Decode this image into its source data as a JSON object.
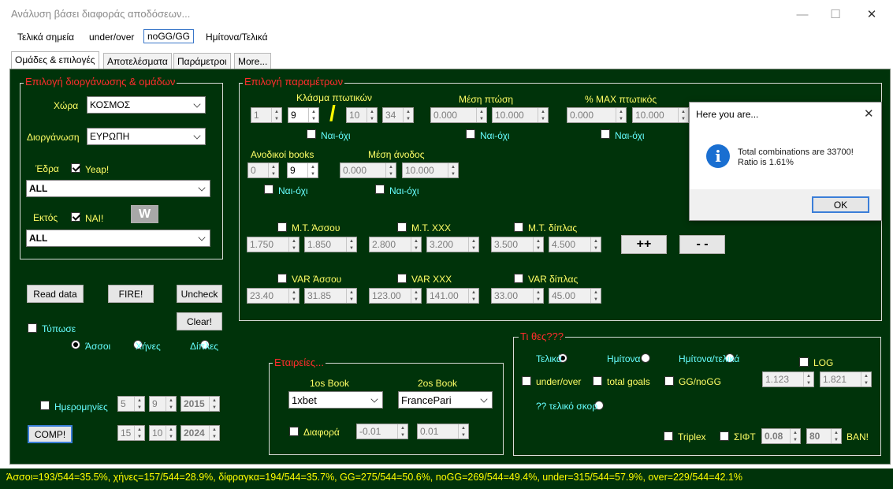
{
  "window": {
    "title": "Ανάλυση βάσει διαφοράς αποδόσεων...",
    "minimize": "—",
    "maximize": "☐",
    "close": "✕"
  },
  "menu": [
    "Τελικά σημεία",
    "under/over",
    "noGG/GG",
    "Ημίτονα/Τελικά"
  ],
  "tabs": [
    "Ομάδες & επιλογές",
    "Αποτελέσματα",
    "Παράμετροι",
    "More..."
  ],
  "teams": {
    "title": "Επιλογή διοργάνωσης & ομάδων",
    "country_label": "Χώρα",
    "country_value": "ΚΟΣΜΟΣ",
    "league_label": "Διοργάνωση",
    "league_value": "ΕΥΡΩΠΗ",
    "home_label": "Έδρα",
    "home_check": "Yeap!",
    "home_value": "ALL",
    "away_label": "Εκτός",
    "away_check": "NAI!",
    "w_button": "W",
    "away_value": "ALL"
  },
  "buttons": {
    "read": "Read data",
    "fire": "FIRE!",
    "uncheck": "Uncheck",
    "clear": "Clear!",
    "comp": "COMP!",
    "plusplus": "++",
    "minusminus": "- -"
  },
  "print": {
    "label": "Τύπωσε",
    "opt1": "Άσσοι",
    "opt2": "Χήνες",
    "opt3": "Δίπλες"
  },
  "dates": {
    "label": "Ημερομηνίες",
    "from": [
      "5",
      "9",
      "2015"
    ],
    "to": [
      "15",
      "10",
      "2024"
    ]
  },
  "params": {
    "title": "Επιλογή παραμέτρων",
    "fraction_label": "Κλάσμα πτωτικών",
    "fraction_vals": [
      "1",
      "9",
      "10",
      "34"
    ],
    "slash": "/",
    "mean_drop_label": "Μέση πτώση",
    "mean_drop_vals": [
      "0.000",
      "10.000"
    ],
    "max_drop_label": "% MAX πτωτικός",
    "max_drop_vals": [
      "0.000",
      "10.000"
    ],
    "yesno": "Ναι-όχι",
    "up_books_label": "Ανοδικοί books",
    "up_books_vals": [
      "0",
      "9"
    ],
    "mean_up_label": "Μέση άνοδος",
    "mean_up_vals": [
      "0.000",
      "10.000"
    ],
    "mt1_label": "Μ.Τ. Άσσου",
    "mt1_vals": [
      "1.750",
      "1.850"
    ],
    "mt2_label": "Μ.Τ. ΧΧΧ",
    "mt2_vals": [
      "2.800",
      "3.200"
    ],
    "mt3_label": "Μ.Τ. δίπλας",
    "mt3_vals": [
      "3.500",
      "4.500"
    ],
    "var1_label": "VAR Άσσου",
    "var1_vals": [
      "23.40",
      "31.85"
    ],
    "var2_label": "VAR ΧΧΧ",
    "var2_vals": [
      "123.00",
      "141.00"
    ],
    "var3_label": "VAR δίπλας",
    "var3_vals": [
      "33.00",
      "45.00"
    ]
  },
  "companies": {
    "title": "Εταιρείες...",
    "book1_label": "1os Book",
    "book1_value": "1xbet",
    "book2_label": "2os Book",
    "book2_value": "FrancePari",
    "diff_label": "Διαφορά",
    "diff_vals": [
      "-0.01",
      "0.01"
    ]
  },
  "bets": {
    "title": "Τι θες???",
    "r1": "Τελικά",
    "r2": "Ημίτονα",
    "r3": "Ημίτονα/τελικά",
    "log": "LOG",
    "log_vals": [
      "1.123",
      "1.821"
    ],
    "c1": "under/over",
    "c2": "total goals",
    "c3": "GG/noGG",
    "r4": "?? τελικό σκορ",
    "triplex": "Triplex",
    "sift": "ΣΙΦΤ",
    "sift_vals": [
      "0.08",
      "80"
    ],
    "ban": "BAN!"
  },
  "dialog": {
    "title": "Here you are...",
    "line1": "Total combinations are 33700!",
    "line2": "Ratio is 1.61%",
    "ok": "OK",
    "close": "✕",
    "icon": "i"
  },
  "status": "Άσσοι=193/544=35.5%, χήνες=157/544=28.9%, δίφραγκα=194/544=35.7%, GG=275/544=50.6%, noGG=269/544=49.4%, under=315/544=57.9%, over=229/544=42.1%",
  "colors": {
    "panel_bg": "#00330a",
    "group_title": "#ff2d2d",
    "yellow_label": "#ffff66",
    "cyan_label": "#66ffff",
    "status_text": "#ffff00"
  }
}
